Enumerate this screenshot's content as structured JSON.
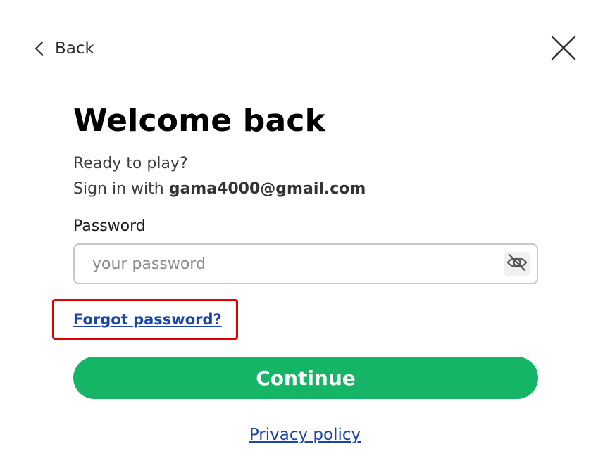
{
  "header": {
    "back_label": "Back",
    "back_icon": "chevron-left-icon",
    "close_icon": "close-icon"
  },
  "main": {
    "title": "Welcome back",
    "subtitle_line1": "Ready to play?",
    "subtitle_line2_prefix": "Sign in with ",
    "email": "gama4000@gmail.com"
  },
  "password_field": {
    "label": "Password",
    "value": "",
    "placeholder": "your password",
    "toggle_icon": "eye-off-icon"
  },
  "links": {
    "forgot_password": "Forgot password?",
    "privacy_policy": "Privacy policy"
  },
  "actions": {
    "continue_label": "Continue"
  },
  "colors": {
    "primary_button": "#14b566",
    "link": "#1b46a8",
    "highlight_border": "#e00000"
  }
}
